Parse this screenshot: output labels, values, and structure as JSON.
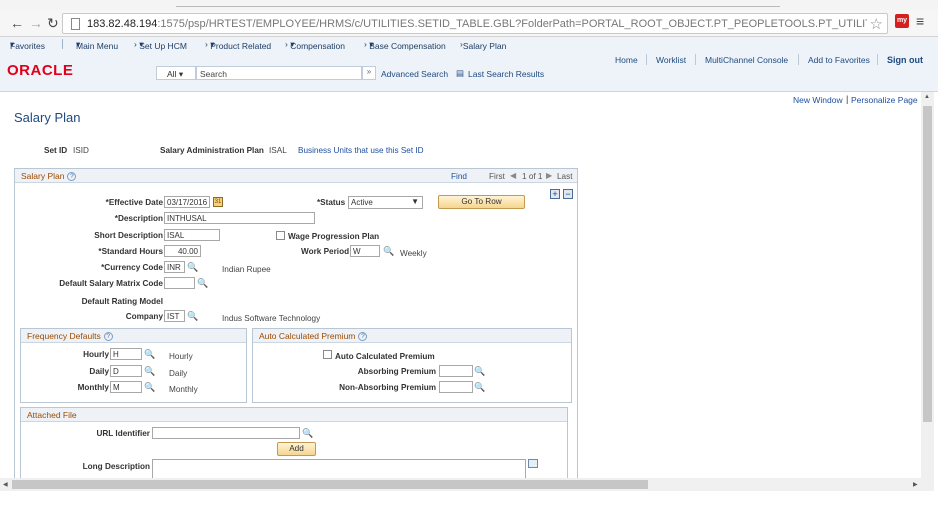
{
  "browser": {
    "url_host": "183.82.48.194",
    "url_rest": ":1575/psp/HRTEST/EMPLOYEE/HRMS/c/UTILITIES.SETID_TABLE.GBL?FolderPath=PORTAL_ROOT_OBJECT.PT_PEOPLETOOLS.PT_UTILITIES.PT_ADMINISTI",
    "ext_label": "my"
  },
  "breadcrumb": {
    "favorites": "Favorites",
    "main_menu": "Main Menu",
    "setup_hcm": "Set Up HCM",
    "product_related": "Product Related",
    "compensation": "Compensation",
    "base_compensation": "Base Compensation",
    "salary_plan": "Salary Plan"
  },
  "header": {
    "logo": "ORACLE",
    "search_scope": "All",
    "search_placeholder": "Search",
    "advanced_search": "Advanced Search",
    "last_search_results": "Last Search Results",
    "home": "Home",
    "worklist": "Worklist",
    "multichannel": "MultiChannel Console",
    "add_favorites": "Add to Favorites",
    "sign_out": "Sign out"
  },
  "page": {
    "new_window": "New Window",
    "personalize": "Personalize Page",
    "title": "Salary Plan",
    "setid_label": "Set ID",
    "setid_value": "ISID",
    "sal_admin_label": "Salary Administration Plan",
    "sal_admin_value": "ISAL",
    "bu_link": "Business Units that use this Set ID"
  },
  "salary_plan": {
    "header": "Salary Plan",
    "find": "Find",
    "first": "First",
    "counter": "1 of 1",
    "last": "Last",
    "plus": "+",
    "minus": "−",
    "eff_date_label": "*Effective Date",
    "eff_date_value": "03/17/2016",
    "status_label": "*Status",
    "status_value": "Active",
    "go_to_row": "Go To Row",
    "desc_label": "*Description",
    "desc_value": "INTHUSAL",
    "short_desc_label": "Short Description",
    "short_desc_value": "ISAL",
    "wage_label": "Wage Progression Plan",
    "std_hours_label": "*Standard Hours",
    "std_hours_value": "40.00",
    "work_period_label": "Work Period",
    "work_period_value": "W",
    "work_period_desc": "Weekly",
    "currency_label": "*Currency Code",
    "currency_value": "INR",
    "currency_desc": "Indian Rupee",
    "matrix_label": "Default Salary Matrix Code",
    "matrix_value": "",
    "rating_label": "Default Rating Model",
    "company_label": "Company",
    "company_value": "IST",
    "company_desc": "Indus Software Technology"
  },
  "frequency": {
    "header": "Frequency Defaults",
    "hourly_label": "Hourly",
    "hourly_value": "H",
    "hourly_desc": "Hourly",
    "daily_label": "Daily",
    "daily_value": "D",
    "daily_desc": "Daily",
    "monthly_label": "Monthly",
    "monthly_value": "M",
    "monthly_desc": "Monthly"
  },
  "premium": {
    "header": "Auto Calculated Premium",
    "auto_label": "Auto Calculated Premium",
    "absorbing_label": "Absorbing Premium",
    "absorbing_value": "",
    "non_absorbing_label": "Non-Absorbing Premium",
    "non_absorbing_value": ""
  },
  "attached": {
    "header": "Attached File",
    "url_id_label": "URL Identifier",
    "url_id_value": "",
    "add": "Add",
    "long_desc_label": "Long Description",
    "long_desc_value": ""
  }
}
